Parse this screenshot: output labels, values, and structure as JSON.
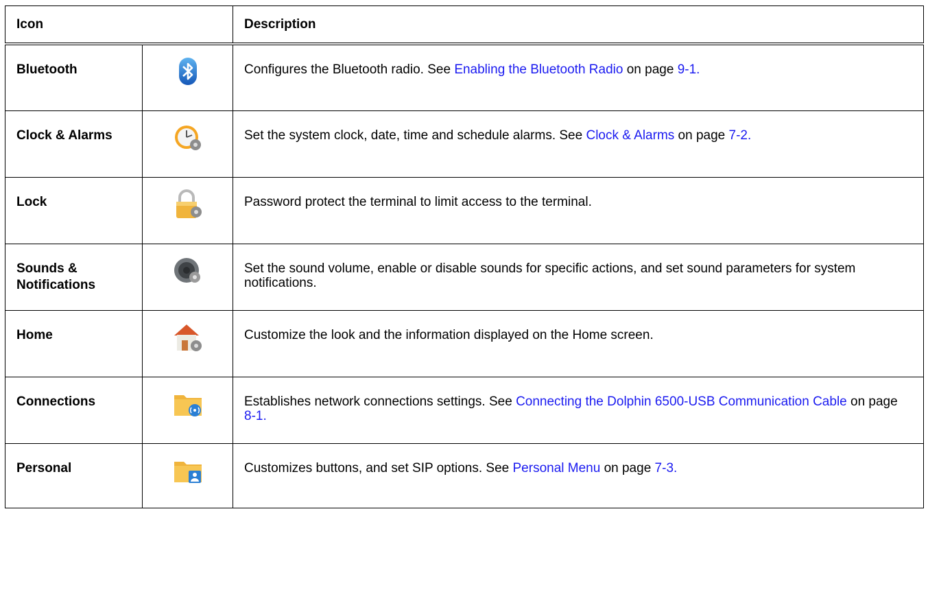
{
  "header": {
    "icon": "Icon",
    "description": "Description"
  },
  "rows": [
    {
      "name": "Bluetooth",
      "icon": "bluetooth-icon",
      "desc": {
        "pre": "Configures the Bluetooth radio. See ",
        "link": "Enabling the Bluetooth Radio",
        "mid": " on page ",
        "page": "9-1.",
        "post": ""
      }
    },
    {
      "name": "Clock & Alarms",
      "icon": "clock-gear-icon",
      "desc": {
        "pre": "Set the system clock, date, time and schedule alarms. See ",
        "link": "Clock & Alarms",
        "mid": " on page ",
        "page": "7-2.",
        "post": ""
      }
    },
    {
      "name": "Lock",
      "icon": "padlock-gear-icon",
      "desc": {
        "pre": "Password protect the terminal to limit access to the terminal.",
        "link": "",
        "mid": "",
        "page": "",
        "post": ""
      }
    },
    {
      "name": "Sounds & Notifications",
      "icon": "speaker-gear-icon",
      "desc": {
        "pre": "Set the sound volume, enable or disable sounds for specific actions, and set sound parameters for system notifications.",
        "link": "",
        "mid": "",
        "page": "",
        "post": ""
      }
    },
    {
      "name": "Home",
      "icon": "house-gear-icon",
      "desc": {
        "pre": "Customize the look and the information displayed on the Home screen.",
        "link": "",
        "mid": "",
        "page": "",
        "post": ""
      }
    },
    {
      "name": "Connections",
      "icon": "folder-wireless-icon",
      "desc": {
        "pre": "Establishes network connections settings. See ",
        "link": "Connecting the Dolphin 6500-USB Communication Cable",
        "mid": " on page ",
        "page": "8-1.",
        "post": ""
      }
    },
    {
      "name": "Personal",
      "icon": "folder-person-icon",
      "desc": {
        "pre": "Customizes buttons, and set SIP options. See ",
        "link": "Personal Menu",
        "mid": " on page ",
        "page": "7-3.",
        "post": ""
      }
    }
  ]
}
